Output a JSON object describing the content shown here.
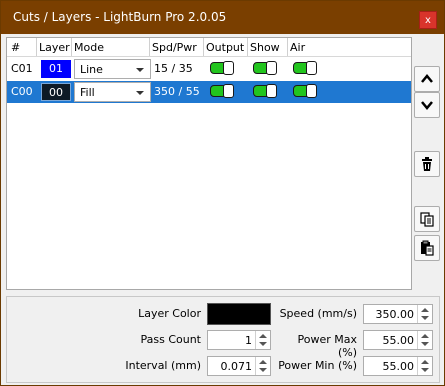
{
  "window": {
    "title": "Cuts / Layers - LightBurn Pro 2.0.05",
    "close_label": "x"
  },
  "table": {
    "headers": [
      "#",
      "Layer",
      "Mode",
      "Spd/Pwr",
      "Output",
      "Show",
      "Air"
    ],
    "rows": [
      {
        "id": "C01",
        "layer": "01",
        "layer_color": "#0000ff",
        "mode": "Line",
        "spd_pwr": "15 / 35",
        "output": true,
        "show": true,
        "air": true,
        "selected": false
      },
      {
        "id": "C00",
        "layer": "00",
        "layer_color": "#0d1a26",
        "mode": "Fill",
        "spd_pwr": "350 / 55",
        "output": true,
        "show": true,
        "air": true,
        "selected": true
      }
    ]
  },
  "side_buttons": [
    "move-up-icon",
    "move-down-icon",
    "delete-icon",
    "copy-icon",
    "paste-icon"
  ],
  "settings": {
    "layer_color_label": "Layer Color",
    "layer_color": "#000000",
    "pass_count_label": "Pass Count",
    "pass_count": "1",
    "interval_label": "Interval (mm)",
    "interval": "0.071",
    "speed_label": "Speed (mm/s)",
    "speed": "350.00",
    "power_max_label": "Power Max (%)",
    "power_max": "55.00",
    "power_min_label": "Power Min (%)",
    "power_min": "55.00"
  },
  "colors": {
    "titlebar": "#7a3f00",
    "selection": "#1f78d1",
    "toggle_on": "#22c51e",
    "close": "#d9342b"
  }
}
